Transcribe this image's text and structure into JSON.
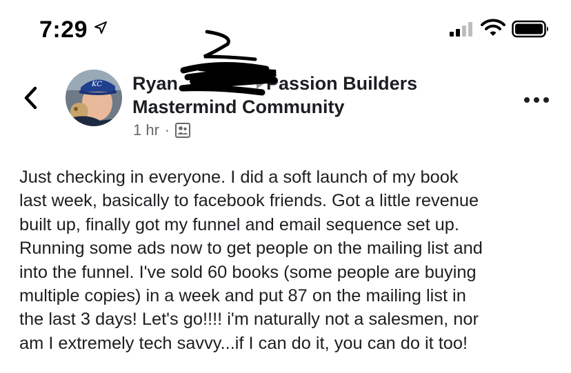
{
  "status_bar": {
    "time": "7:29",
    "location_icon": "location-arrow-icon",
    "signal_icon": "cellular-signal-icon",
    "wifi_icon": "wifi-icon",
    "battery_icon": "battery-icon"
  },
  "post": {
    "author_name": "Ryan",
    "group_name_line1": "Passion Builders",
    "group_name_line2": "Mastermind Community",
    "timestamp": "1 hr",
    "separator": "·",
    "audience_icon": "group-members-icon",
    "body_lines": [
      "Just checking in everyone. I did a soft launch of my book",
      "last week, basically to facebook friends. Got a little revenue",
      "built up, finally got my funnel and email sequence set up.",
      "Running some ads now to get people on the mailing list and",
      "into the funnel. I've sold 60 books (some people are buying",
      "multiple copies) in a week and put 87 on the mailing list in",
      "the last 3 days! Let's go!!!! i'm naturally not a salesmen, nor",
      "am I extremely tech savvy...if I can do it, you can do it too!"
    ]
  },
  "colors": {
    "text": "#1c1e21",
    "secondary_text": "#65676b",
    "arrow_gray": "#8a8d91",
    "redaction": "#000000"
  }
}
